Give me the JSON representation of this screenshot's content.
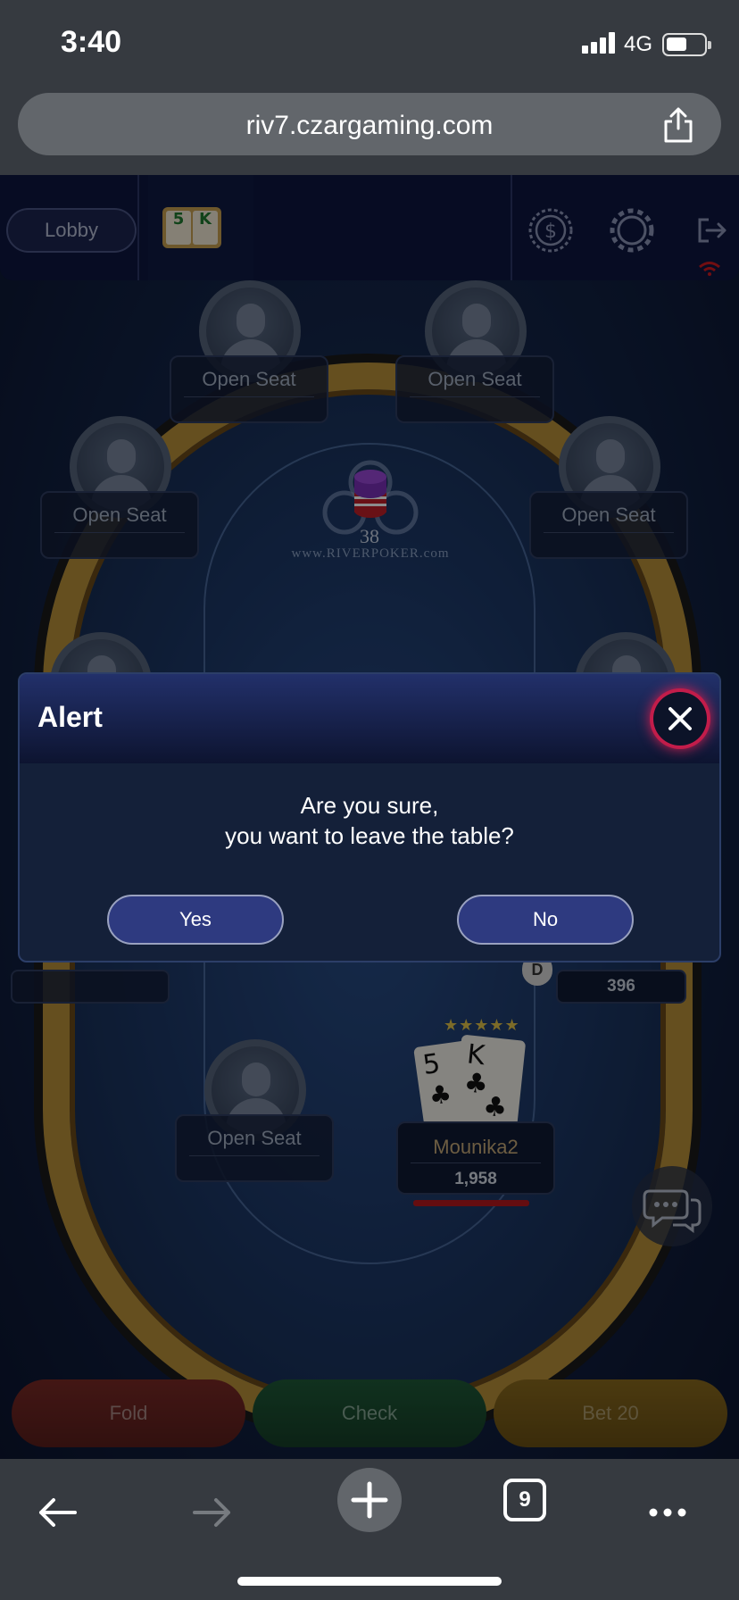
{
  "status_bar": {
    "time": "3:40",
    "network": "4G"
  },
  "browser": {
    "url": "riv7.czargaming.com",
    "tabs_count": "9"
  },
  "toolbar": {
    "lobby_label": "Lobby",
    "hand_cards": [
      "5",
      "K"
    ]
  },
  "table": {
    "pot": "38",
    "brand": "www.RIVERPOKER.com",
    "open_seat_label": "Open Seat",
    "seats": [
      "Open Seat",
      "Open Seat",
      "Open Seat",
      "Open Seat",
      "Open Seat"
    ],
    "dealer_button": "D",
    "opponent_stack": "396"
  },
  "player": {
    "name": "Mounika2",
    "stack": "1,958",
    "cards": [
      "5",
      "K"
    ],
    "stars": "★★★★★"
  },
  "actions": {
    "fold": "Fold",
    "check": "Check",
    "bet": "Bet  20"
  },
  "alert": {
    "title": "Alert",
    "message_line1": "Are you sure,",
    "message_line2": "you want to leave the table?",
    "yes_label": "Yes",
    "no_label": "No"
  },
  "icons": [
    "share-icon",
    "cashier-icon",
    "settings-icon",
    "logout-icon",
    "wifi-icon",
    "chat-icon",
    "close-icon",
    "back-icon",
    "forward-icon",
    "new-tab-icon",
    "tabs-icon",
    "more-icon"
  ],
  "colors": {
    "accent_close": "#d02050",
    "button_blue": "#2e3a80",
    "fold": "#7a2a26",
    "check": "#1f5a38",
    "bet": "#8a6a1e"
  }
}
